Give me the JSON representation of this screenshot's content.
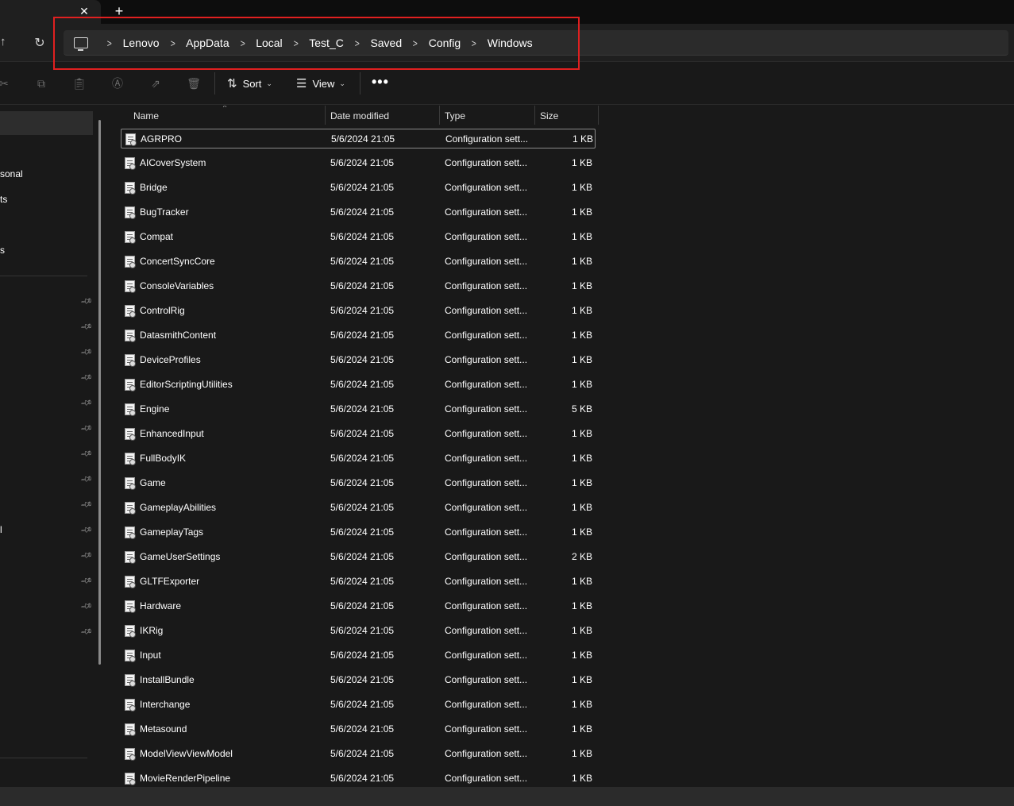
{
  "tab": {
    "close_glyph": "✕",
    "new_tab_glyph": "+"
  },
  "nav": {
    "up_glyph": "↑",
    "refresh_glyph": "↻"
  },
  "breadcrumbs": [
    "Lenovo",
    "AppData",
    "Local",
    "Test_C",
    "Saved",
    "Config",
    "Windows"
  ],
  "toolbar": {
    "icons": [
      "cut-icon",
      "copy-icon",
      "paste-icon",
      "rename-icon",
      "share-icon",
      "delete-icon"
    ],
    "sort_label": "Sort",
    "view_label": "View",
    "more_glyph": "•••"
  },
  "sidebar": {
    "partial_labels": [
      "sonal",
      "ts",
      "s",
      "l"
    ]
  },
  "columns": {
    "name": "Name",
    "date": "Date modified",
    "type": "Type",
    "size": "Size"
  },
  "files": [
    {
      "name": "AGRPRO",
      "date": "5/6/2024 21:05",
      "type": "Configuration sett...",
      "size": "1 KB"
    },
    {
      "name": "AICoverSystem",
      "date": "5/6/2024 21:05",
      "type": "Configuration sett...",
      "size": "1 KB"
    },
    {
      "name": "Bridge",
      "date": "5/6/2024 21:05",
      "type": "Configuration sett...",
      "size": "1 KB"
    },
    {
      "name": "BugTracker",
      "date": "5/6/2024 21:05",
      "type": "Configuration sett...",
      "size": "1 KB"
    },
    {
      "name": "Compat",
      "date": "5/6/2024 21:05",
      "type": "Configuration sett...",
      "size": "1 KB"
    },
    {
      "name": "ConcertSyncCore",
      "date": "5/6/2024 21:05",
      "type": "Configuration sett...",
      "size": "1 KB"
    },
    {
      "name": "ConsoleVariables",
      "date": "5/6/2024 21:05",
      "type": "Configuration sett...",
      "size": "1 KB"
    },
    {
      "name": "ControlRig",
      "date": "5/6/2024 21:05",
      "type": "Configuration sett...",
      "size": "1 KB"
    },
    {
      "name": "DatasmithContent",
      "date": "5/6/2024 21:05",
      "type": "Configuration sett...",
      "size": "1 KB"
    },
    {
      "name": "DeviceProfiles",
      "date": "5/6/2024 21:05",
      "type": "Configuration sett...",
      "size": "1 KB"
    },
    {
      "name": "EditorScriptingUtilities",
      "date": "5/6/2024 21:05",
      "type": "Configuration sett...",
      "size": "1 KB"
    },
    {
      "name": "Engine",
      "date": "5/6/2024 21:05",
      "type": "Configuration sett...",
      "size": "5 KB"
    },
    {
      "name": "EnhancedInput",
      "date": "5/6/2024 21:05",
      "type": "Configuration sett...",
      "size": "1 KB"
    },
    {
      "name": "FullBodyIK",
      "date": "5/6/2024 21:05",
      "type": "Configuration sett...",
      "size": "1 KB"
    },
    {
      "name": "Game",
      "date": "5/6/2024 21:05",
      "type": "Configuration sett...",
      "size": "1 KB"
    },
    {
      "name": "GameplayAbilities",
      "date": "5/6/2024 21:05",
      "type": "Configuration sett...",
      "size": "1 KB"
    },
    {
      "name": "GameplayTags",
      "date": "5/6/2024 21:05",
      "type": "Configuration sett...",
      "size": "1 KB"
    },
    {
      "name": "GameUserSettings",
      "date": "5/6/2024 21:05",
      "type": "Configuration sett...",
      "size": "2 KB"
    },
    {
      "name": "GLTFExporter",
      "date": "5/6/2024 21:05",
      "type": "Configuration sett...",
      "size": "1 KB"
    },
    {
      "name": "Hardware",
      "date": "5/6/2024 21:05",
      "type": "Configuration sett...",
      "size": "1 KB"
    },
    {
      "name": "IKRig",
      "date": "5/6/2024 21:05",
      "type": "Configuration sett...",
      "size": "1 KB"
    },
    {
      "name": "Input",
      "date": "5/6/2024 21:05",
      "type": "Configuration sett...",
      "size": "1 KB"
    },
    {
      "name": "InstallBundle",
      "date": "5/6/2024 21:05",
      "type": "Configuration sett...",
      "size": "1 KB"
    },
    {
      "name": "Interchange",
      "date": "5/6/2024 21:05",
      "type": "Configuration sett...",
      "size": "1 KB"
    },
    {
      "name": "Metasound",
      "date": "5/6/2024 21:05",
      "type": "Configuration sett...",
      "size": "1 KB"
    },
    {
      "name": "ModelViewViewModel",
      "date": "5/6/2024 21:05",
      "type": "Configuration sett...",
      "size": "1 KB"
    },
    {
      "name": "MovieRenderPipeline",
      "date": "5/6/2024 21:05",
      "type": "Configuration sett...",
      "size": "1 KB"
    }
  ],
  "colors": {
    "background": "#191919",
    "highlight_box": "#e02020",
    "row_focus_border": "#8a8a8a"
  }
}
